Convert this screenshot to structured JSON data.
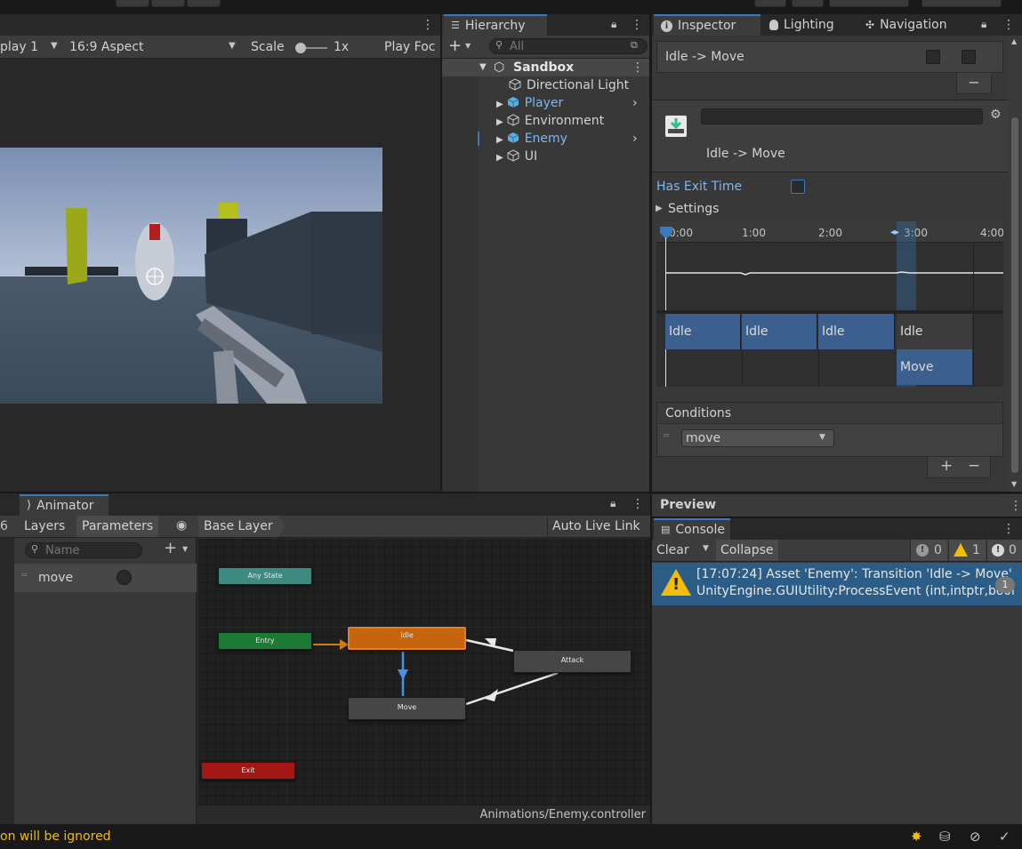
{
  "game_toolbar": {
    "display": "play 1",
    "aspect": "16:9 Aspect",
    "scale_label": "Scale",
    "scale_value": "1x",
    "play_focused": "Play Foc"
  },
  "hierarchy": {
    "tab_label": "Hierarchy",
    "search_placeholder": "All",
    "add_label": "+",
    "scene": "Sandbox",
    "items": [
      {
        "label": "Directional Light"
      },
      {
        "label": "Player"
      },
      {
        "label": "Environment"
      },
      {
        "label": "Enemy"
      },
      {
        "label": "UI"
      }
    ]
  },
  "inspector": {
    "tabs": [
      "Inspector",
      "Lighting",
      "Navigation"
    ],
    "transition_row": "Idle -> Move",
    "transition_title": "Idle -> Move",
    "has_exit_time_label": "Has Exit Time",
    "settings_label": "Settings",
    "timeline_ticks": [
      "0:00",
      "1:00",
      "2:00",
      "3:00",
      "4:00"
    ],
    "timeline_blocks_top": [
      "Idle",
      "Idle",
      "Idle",
      "Idle"
    ],
    "timeline_block_bottom": "Move",
    "conditions_label": "Conditions",
    "condition_param": "move",
    "plus": "+",
    "minus": "−",
    "preview_label": "Preview"
  },
  "animator": {
    "tab_label": "Animator",
    "left_num": "6",
    "tabs": [
      "Layers",
      "Parameters"
    ],
    "base_layer": "Base Layer",
    "auto_live_link": "Auto Live Link",
    "name_placeholder": "Name",
    "params": [
      {
        "name": "move"
      }
    ],
    "nodes": {
      "any_state": "Any State",
      "entry": "Entry",
      "idle": "Idle",
      "attack": "Attack",
      "move": "Move",
      "exit": "Exit"
    },
    "footer_path": "Animations/Enemy.controller"
  },
  "console": {
    "tab_label": "Console",
    "clear": "Clear",
    "collapse": "Collapse",
    "count_log": "0",
    "count_warn": "1",
    "count_error": "0",
    "entry_line1": "[17:07:24] Asset 'Enemy': Transition 'Idle -> Move'",
    "entry_line2": "UnityEngine.GUIUtility:ProcessEvent (int,intptr,bool",
    "entry_count": "1"
  },
  "status_bar": {
    "message": "on will be ignored"
  },
  "colors": {
    "accent": "#3a79bb",
    "selection": "#2c5d87",
    "idle_node": "#c7650e",
    "entry_node": "#1d7a35",
    "any_state_node": "#3d8a80",
    "exit_node": "#a51616",
    "warning": "#f4bc02"
  }
}
